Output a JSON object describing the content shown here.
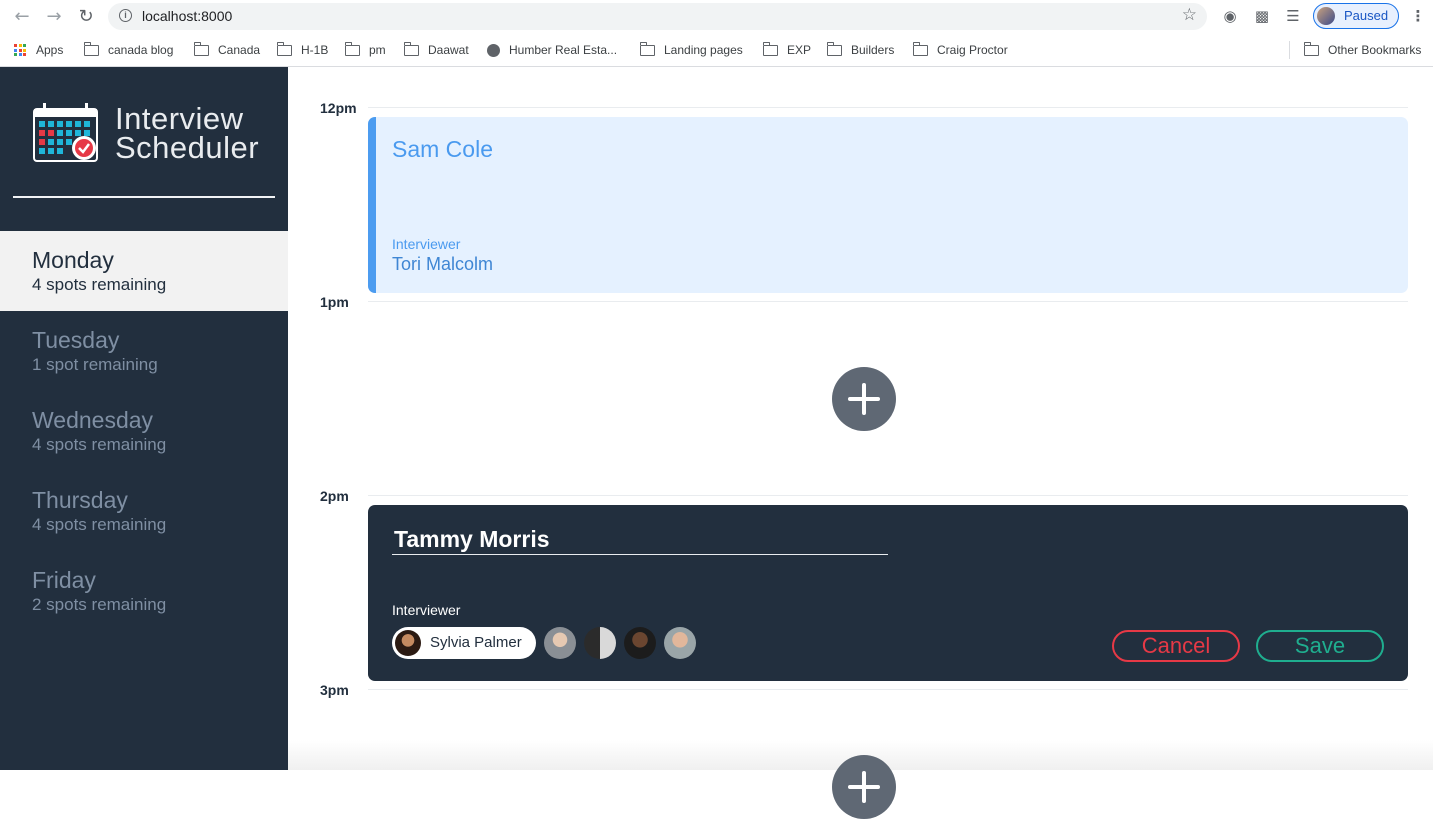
{
  "browser": {
    "url": "localhost:8000",
    "profile_label": "Paused",
    "bookmarks": [
      "Apps",
      "canada blog",
      "Canada",
      "H-1B",
      "pm",
      "Daawat",
      "Humber Real Esta...",
      "Landing pages",
      "EXP",
      "Builders",
      "Craig Proctor",
      "Other Bookmarks"
    ]
  },
  "sidebar": {
    "brand_line1": "Interview",
    "brand_line2": "Scheduler",
    "days": [
      {
        "name": "Monday",
        "spots": "4 spots remaining",
        "selected": true
      },
      {
        "name": "Tuesday",
        "spots": "1 spot remaining",
        "selected": false
      },
      {
        "name": "Wednesday",
        "spots": "4 spots remaining",
        "selected": false
      },
      {
        "name": "Thursday",
        "spots": "4 spots remaining",
        "selected": false
      },
      {
        "name": "Friday",
        "spots": "2 spots remaining",
        "selected": false
      }
    ]
  },
  "schedule": {
    "times": [
      "12pm",
      "1pm",
      "2pm",
      "3pm"
    ],
    "appointment": {
      "student": "Sam Cole",
      "interviewer_label": "Interviewer",
      "interviewer": "Tori Malcolm"
    },
    "form": {
      "student_value": "Tammy Morris",
      "interviewer_label": "Interviewer",
      "selected_interviewer": "Sylvia Palmer",
      "cancel_label": "Cancel",
      "save_label": "Save"
    }
  },
  "colors": {
    "sidebar_bg": "#222f3e",
    "appointment_bg": "#e5f1ff",
    "accent_blue": "#4a9aef",
    "cancel_red": "#e63946",
    "save_green": "#1fae8f"
  }
}
